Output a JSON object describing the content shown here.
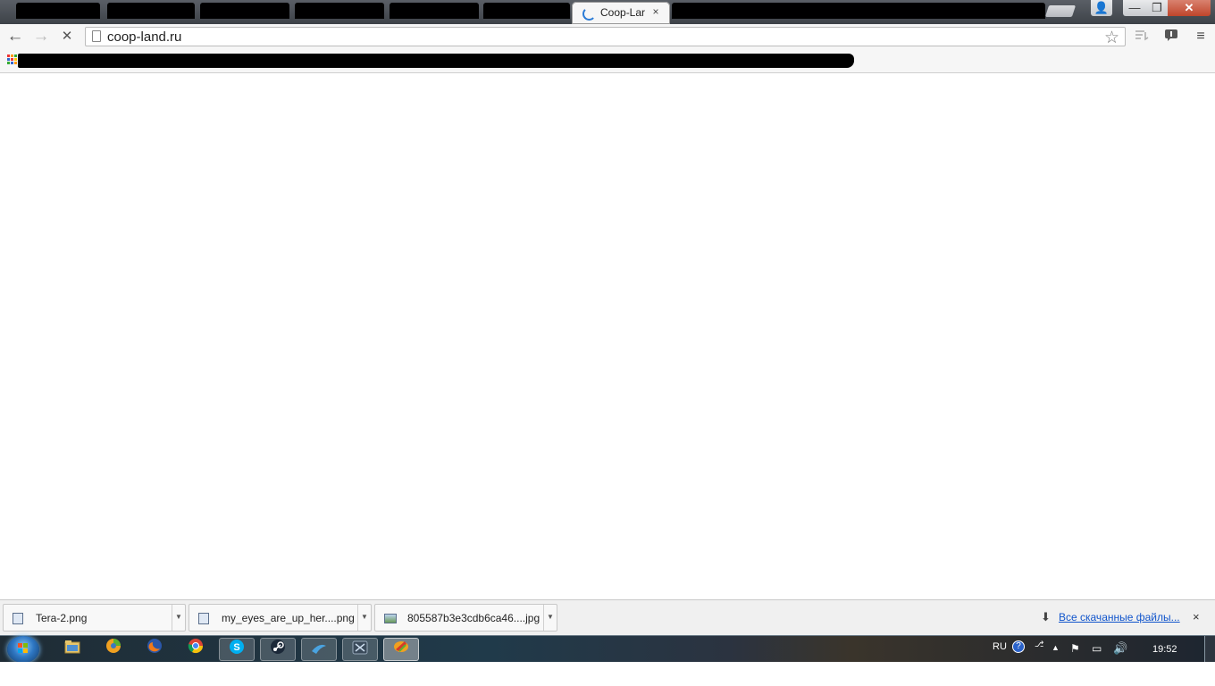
{
  "window": {
    "controls": {
      "profile": "👤",
      "minimize": "—",
      "maximize": "❐",
      "close": "✕"
    }
  },
  "tabs": {
    "active": {
      "title": "Coop-Lar",
      "close": "×"
    }
  },
  "toolbar": {
    "back": "←",
    "forward": "→",
    "stop": "✕",
    "url": "coop-land.ru",
    "bookmark_star": "☆",
    "menu": "≡"
  },
  "downloads": {
    "items": [
      {
        "name": "Tera-2.png"
      },
      {
        "name": "my_eyes_are_up_her....png"
      },
      {
        "name": "805587b3e3cdb6ca46....jpg"
      }
    ],
    "show_all": "Все скачанные файлы...",
    "close": "×"
  },
  "taskbar": {
    "language": "RU",
    "clock": "19:52"
  },
  "colors": {
    "accent": "#1a5fb4",
    "link": "#1155cc",
    "close_button": "#c0452b"
  }
}
